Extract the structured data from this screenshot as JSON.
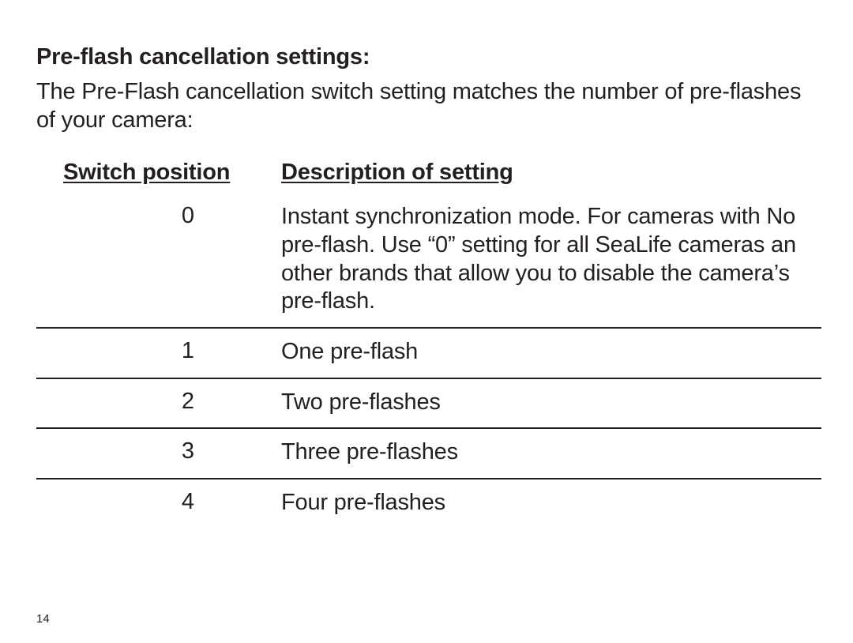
{
  "heading": "Pre-flash cancellation settings:",
  "intro": "The Pre-Flash cancellation switch setting matches the number of pre-flashes of your camera:",
  "columns": {
    "position": "Switch position",
    "description": "Description of setting"
  },
  "rows": [
    {
      "position": "0",
      "description": "Instant synchronization mode. For cameras with No pre-flash. Use “0” setting for all SeaLife cameras an other brands that allow you to disable the camera’s pre-flash."
    },
    {
      "position": "1",
      "description": "One pre-flash"
    },
    {
      "position": "2",
      "description": "Two pre-flashes"
    },
    {
      "position": "3",
      "description": "Three pre-flashes"
    },
    {
      "position": "4",
      "description": "Four pre-flashes"
    }
  ],
  "page_number": "14"
}
